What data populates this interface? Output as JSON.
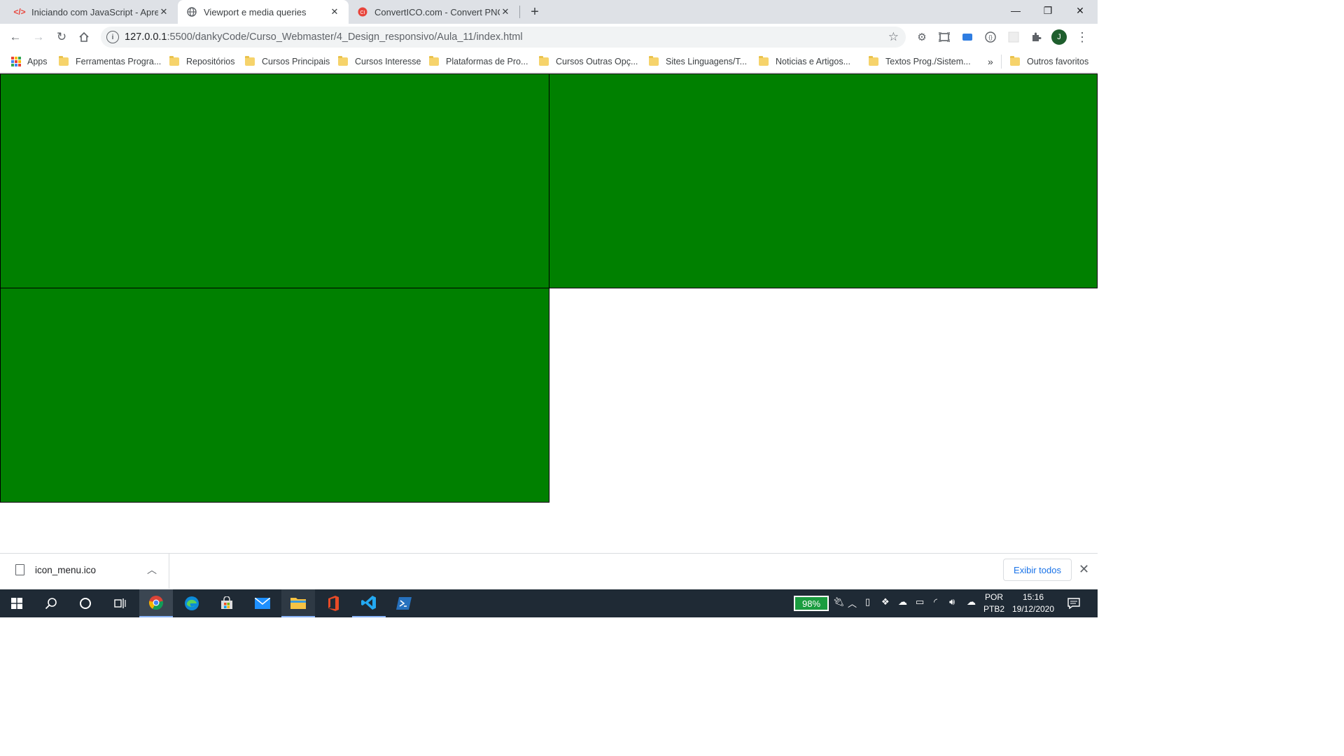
{
  "tabs": [
    {
      "title": "Iniciando com JavaScript - Apres",
      "favicon": "code-icon",
      "favicon_color": "#e8453c"
    },
    {
      "title": "Viewport e media queries",
      "favicon": "globe-icon",
      "favicon_color": "#5f6368"
    },
    {
      "title": "ConvertICO.com - Convert PNG t",
      "favicon": "converter-icon",
      "favicon_color": "#e8453c"
    }
  ],
  "address_bar": {
    "host": "127.0.0.1",
    "path": ":5500/dankyCode/Curso_Webmaster/4_Design_responsivo/Aula_11/index.html"
  },
  "profile_initial": "J",
  "bookmarks": {
    "apps": "Apps",
    "items": [
      "Ferramentas Progra...",
      "Repositórios",
      "Cursos Principais",
      "Cursos Interesse",
      "Plataformas de Pro...",
      "Cursos Outras Opç...",
      "Sites Linguagens/T...",
      "Noticias e Artigos...",
      "Textos Prog./Sistem..."
    ],
    "overflow": "»",
    "other": "Outros favoritos"
  },
  "page": {
    "box_color": "#008000"
  },
  "downloads": {
    "file_name": "icon_menu.ico",
    "show_all": "Exibir todos"
  },
  "taskbar": {
    "battery": "98%",
    "language": "POR",
    "layout": "PTB2",
    "time": "15:16",
    "date": "19/12/2020"
  }
}
